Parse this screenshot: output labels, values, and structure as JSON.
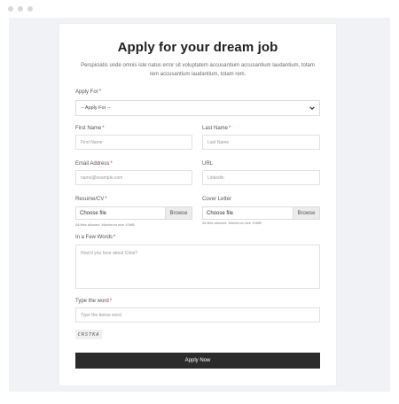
{
  "form": {
    "title": "Apply for your dream job",
    "subtitle": "Perspiciatis unde omnis iste natus error sit voluptatem accusantium accusantium laudantium, totam rem accusantium laudantium, totam rem.",
    "required_mark": "*",
    "apply_for": {
      "label": "Apply For",
      "selected": "-- Apply For --"
    },
    "first_name": {
      "label": "First Name",
      "placeholder": "First Name"
    },
    "last_name": {
      "label": "Last Name",
      "placeholder": "Last Name"
    },
    "email": {
      "label": "Email Address",
      "placeholder": "name@example.com"
    },
    "url": {
      "label": "URL",
      "placeholder": "Linkedin"
    },
    "resume": {
      "label": "Resume/CV",
      "file_text": "Choose file",
      "browse": "Browse",
      "hint": "All files allowed. Maximum size 10MB"
    },
    "cover_letter": {
      "label": "Cover Letter",
      "file_text": "Choose file",
      "browse": "Browse",
      "hint": "All files allowed. Maximum size 10MB"
    },
    "words": {
      "label": "In a Few Words",
      "placeholder": "How'd you hear about Cirlai?"
    },
    "captcha": {
      "label": "Type the word",
      "placeholder": "Type the below word",
      "word": "CRSTKA"
    },
    "submit_label": "Apply Now"
  },
  "icons": {
    "select_arrow": "chevron-down-icon"
  },
  "colors": {
    "button_bg": "#2b2b2b",
    "required": "#dd3333",
    "page_bg": "#f1f2f5"
  }
}
